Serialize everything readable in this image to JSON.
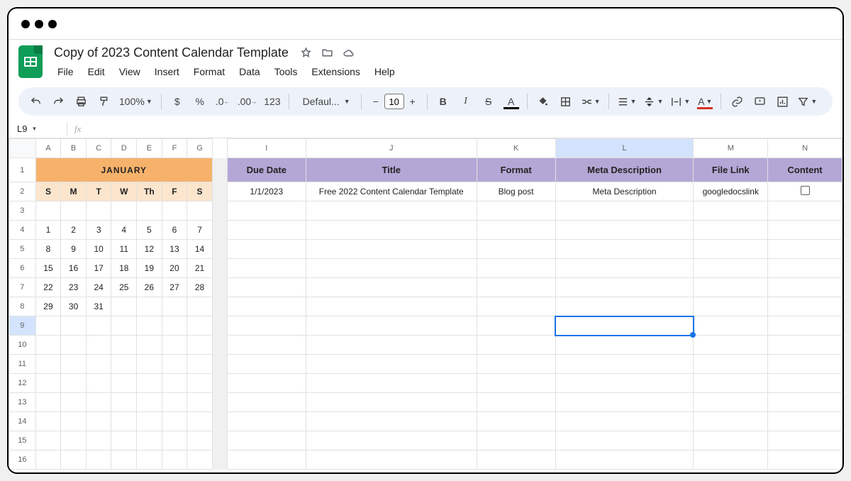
{
  "doc": {
    "title": "Copy of 2023 Content Calendar Template"
  },
  "menu": {
    "file": "File",
    "edit": "Edit",
    "view": "View",
    "insert": "Insert",
    "format": "Format",
    "data": "Data",
    "tools": "Tools",
    "extensions": "Extensions",
    "help": "Help"
  },
  "toolbar": {
    "zoom": "100%",
    "currency_glyph": "$",
    "percent_glyph": "%",
    "numfmt_glyph": "123",
    "font": "Defaul...",
    "font_size": "10",
    "bold": "B",
    "italic": "I",
    "strike": "S",
    "textcolor": "A",
    "fill": "A"
  },
  "namebox": {
    "ref": "L9",
    "fx": "fx"
  },
  "columns": {
    "cal": [
      "A",
      "B",
      "C",
      "D",
      "E",
      "F",
      "G"
    ],
    "spacer": "",
    "data": [
      "I",
      "J",
      "K",
      "L",
      "M",
      "N"
    ]
  },
  "rows": [
    "1",
    "2",
    "3",
    "4",
    "5",
    "6",
    "7",
    "8",
    "9",
    "10",
    "11",
    "12",
    "13",
    "14",
    "15",
    "16"
  ],
  "month": "JANUARY",
  "dow": [
    "S",
    "M",
    "T",
    "W",
    "Th",
    "F",
    "S"
  ],
  "calendar": [
    [
      "",
      "",
      "",
      "",
      "",
      "",
      ""
    ],
    [
      "1",
      "2",
      "3",
      "4",
      "5",
      "6",
      "7"
    ],
    [
      "8",
      "9",
      "10",
      "11",
      "12",
      "13",
      "14"
    ],
    [
      "15",
      "16",
      "17",
      "18",
      "19",
      "20",
      "21"
    ],
    [
      "22",
      "23",
      "24",
      "25",
      "26",
      "27",
      "28"
    ],
    [
      "29",
      "30",
      "31",
      "",
      "",
      "",
      ""
    ]
  ],
  "headers": {
    "due_date": "Due Date",
    "title": "Title",
    "format": "Format",
    "meta": "Meta Description",
    "file_link": "File Link",
    "content": "Content"
  },
  "row2": {
    "due_date": "1/1/2023",
    "title": "Free 2022 Content Calendar Template",
    "format": "Blog post",
    "meta": "Meta Description",
    "file_link": "googledocslink"
  },
  "active_cell": "L9"
}
